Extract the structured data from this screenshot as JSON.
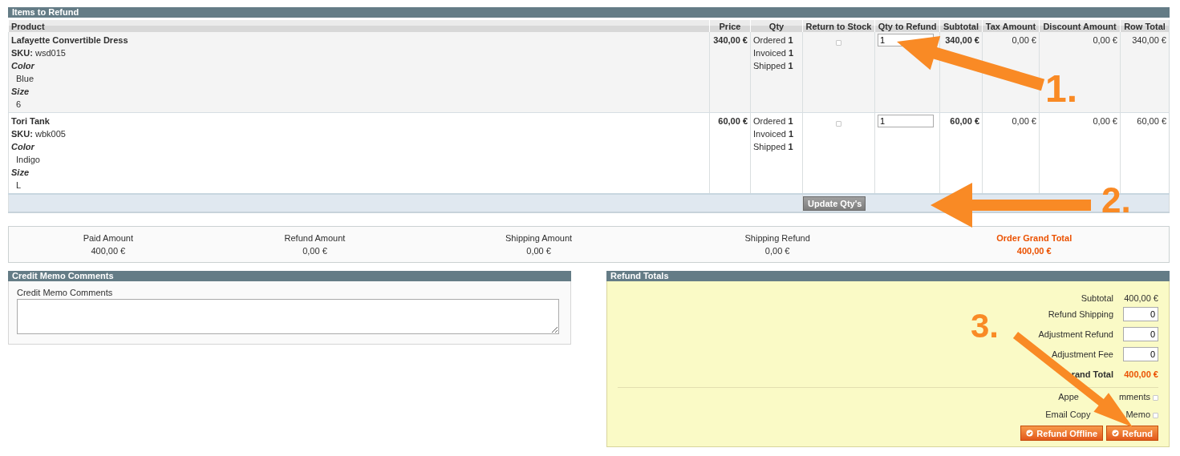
{
  "items_section": {
    "title": "Items to Refund",
    "columns": [
      "Product",
      "Price",
      "Qty",
      "Return to Stock",
      "Qty to Refund",
      "Subtotal",
      "Tax Amount",
      "Discount Amount",
      "Row Total"
    ],
    "rows": [
      {
        "product": "Lafayette Convertible Dress",
        "sku_label": "SKU:",
        "sku": "wsd015",
        "options": [
          {
            "label": "Color",
            "value": "Blue"
          },
          {
            "label": "Size",
            "value": "6"
          }
        ],
        "price": "340,00 €",
        "qty": [
          {
            "label": "Ordered",
            "value": "1"
          },
          {
            "label": "Invoiced",
            "value": "1"
          },
          {
            "label": "Shipped",
            "value": "1"
          }
        ],
        "return_to_stock": false,
        "qty_to_refund": "1",
        "subtotal": "340,00 €",
        "tax_amount": "0,00 €",
        "discount_amount": "0,00 €",
        "row_total": "340,00 €"
      },
      {
        "product": "Tori Tank",
        "sku_label": "SKU:",
        "sku": "wbk005",
        "options": [
          {
            "label": "Color",
            "value": "Indigo"
          },
          {
            "label": "Size",
            "value": "L"
          }
        ],
        "price": "60,00 €",
        "qty": [
          {
            "label": "Ordered",
            "value": "1"
          },
          {
            "label": "Invoiced",
            "value": "1"
          },
          {
            "label": "Shipped",
            "value": "1"
          }
        ],
        "return_to_stock": false,
        "qty_to_refund": "1",
        "subtotal": "60,00 €",
        "tax_amount": "0,00 €",
        "discount_amount": "0,00 €",
        "row_total": "60,00 €"
      }
    ],
    "update_button": "Update Qty's"
  },
  "summary": [
    {
      "label": "Paid Amount",
      "value": "400,00 €",
      "highlight": false
    },
    {
      "label": "Refund Amount",
      "value": "0,00 €",
      "highlight": false
    },
    {
      "label": "Shipping Amount",
      "value": "0,00 €",
      "highlight": false
    },
    {
      "label": "Shipping Refund",
      "value": "0,00 €",
      "highlight": false
    },
    {
      "label": "Order Grand Total",
      "value": "400,00 €",
      "highlight": true
    }
  ],
  "comments": {
    "title": "Credit Memo Comments",
    "label": "Credit Memo Comments"
  },
  "refund_totals": {
    "title": "Refund Totals",
    "lines": [
      {
        "kind": "text",
        "label": "Subtotal",
        "value": "400,00 €"
      },
      {
        "kind": "input",
        "label": "Refund Shipping",
        "value": "0"
      },
      {
        "kind": "input",
        "label": "Adjustment Refund",
        "value": "0"
      },
      {
        "kind": "input",
        "label": "Adjustment Fee",
        "value": "0"
      },
      {
        "kind": "grand",
        "label": "rand Total",
        "value": "400,00 €"
      }
    ],
    "options": [
      {
        "label_fragments": [
          "Appe",
          "mments"
        ],
        "checked": false
      },
      {
        "label_fragments": [
          "Email Copy",
          "Memo"
        ],
        "checked": false
      }
    ],
    "buttons": [
      "Refund Offline",
      "Refund"
    ]
  },
  "annotations": [
    {
      "label": "1."
    },
    {
      "label": "2."
    },
    {
      "label": "3."
    }
  ]
}
